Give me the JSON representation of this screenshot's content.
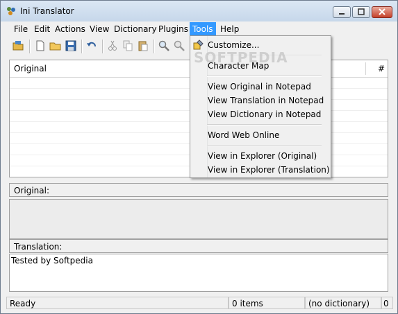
{
  "window": {
    "title": "Ini Translator"
  },
  "menubar": {
    "items": [
      {
        "label": "File"
      },
      {
        "label": "Edit"
      },
      {
        "label": "Actions"
      },
      {
        "label": "View"
      },
      {
        "label": "Dictionary"
      },
      {
        "label": "Plugins"
      },
      {
        "label": "Tools"
      },
      {
        "label": "Help"
      }
    ],
    "active": "Tools"
  },
  "tools_menu": {
    "items": [
      {
        "label": "Customize..."
      },
      {
        "label": "Character Map"
      },
      {
        "label": "View Original in Notepad"
      },
      {
        "label": "View Translation in Notepad"
      },
      {
        "label": "View Dictionary in Notepad"
      },
      {
        "label": "Word Web Online"
      },
      {
        "label": "View in Explorer (Original)"
      },
      {
        "label": "View in Explorer (Translation)"
      }
    ]
  },
  "grid": {
    "col_original": "Original",
    "col_number": "#"
  },
  "original_section": {
    "label": "Original:",
    "text": ""
  },
  "translation_section": {
    "label": "Translation:",
    "text": "Tested by Softpedia"
  },
  "statusbar": {
    "status": "Ready",
    "items": "0 items",
    "dictionary": "(no dictionary)",
    "count": "0"
  },
  "watermark": {
    "text": "SOFTPEDIA"
  },
  "colors": {
    "menu_highlight": "#3399ff",
    "close_button": "#c5412b"
  }
}
